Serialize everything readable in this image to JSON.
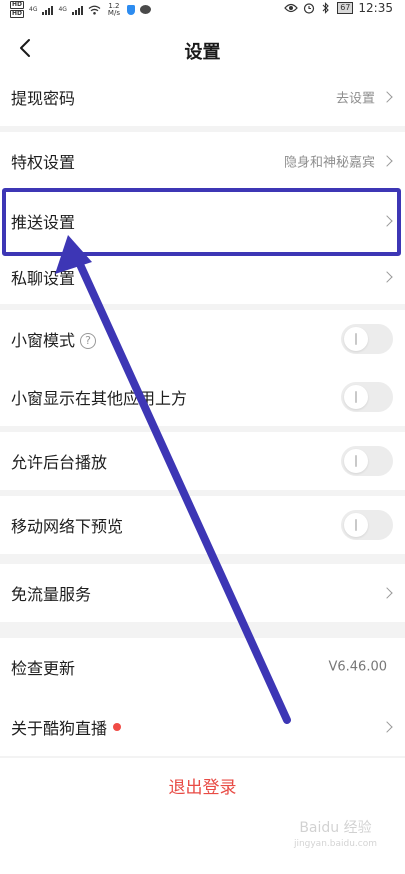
{
  "status_bar": {
    "speed": "1.2 M/s",
    "battery": "67",
    "time": "12:35",
    "hd1": "HD",
    "hd2": "HD",
    "net1": "4G",
    "net2": "4G"
  },
  "nav": {
    "title": "设置",
    "back_icon": "chevron-left-icon"
  },
  "rows": {
    "withdraw_password": {
      "label": "提现密码",
      "value": "去设置"
    },
    "privilege": {
      "label": "特权设置",
      "value": "隐身和神秘嘉宾"
    },
    "push": {
      "label": "推送设置"
    },
    "private_chat": {
      "label": "私聊设置"
    },
    "small_window": {
      "label": "小窗模式",
      "help_icon": "?",
      "toggle_on": false
    },
    "small_window_overlay": {
      "label": "小窗显示在其他应用上方",
      "toggle_on": false
    },
    "background_play": {
      "label": "允许后台播放",
      "toggle_on": false
    },
    "mobile_preview": {
      "label": "移动网络下预览",
      "toggle_on": false
    },
    "free_data": {
      "label": "免流量服务"
    },
    "check_update": {
      "label": "检查更新",
      "value": "V6.46.00"
    },
    "about": {
      "label": "关于酷狗直播",
      "has_red_dot": true
    }
  },
  "logout": {
    "label": "退出登录"
  },
  "annotation": {
    "color": "#3d36b5"
  },
  "watermark": {
    "text": "Baidu 经验",
    "sub": "jingyan.baidu.com"
  },
  "colors": {
    "accent_red": "#e84b45",
    "separator": "#f3f3f3"
  }
}
